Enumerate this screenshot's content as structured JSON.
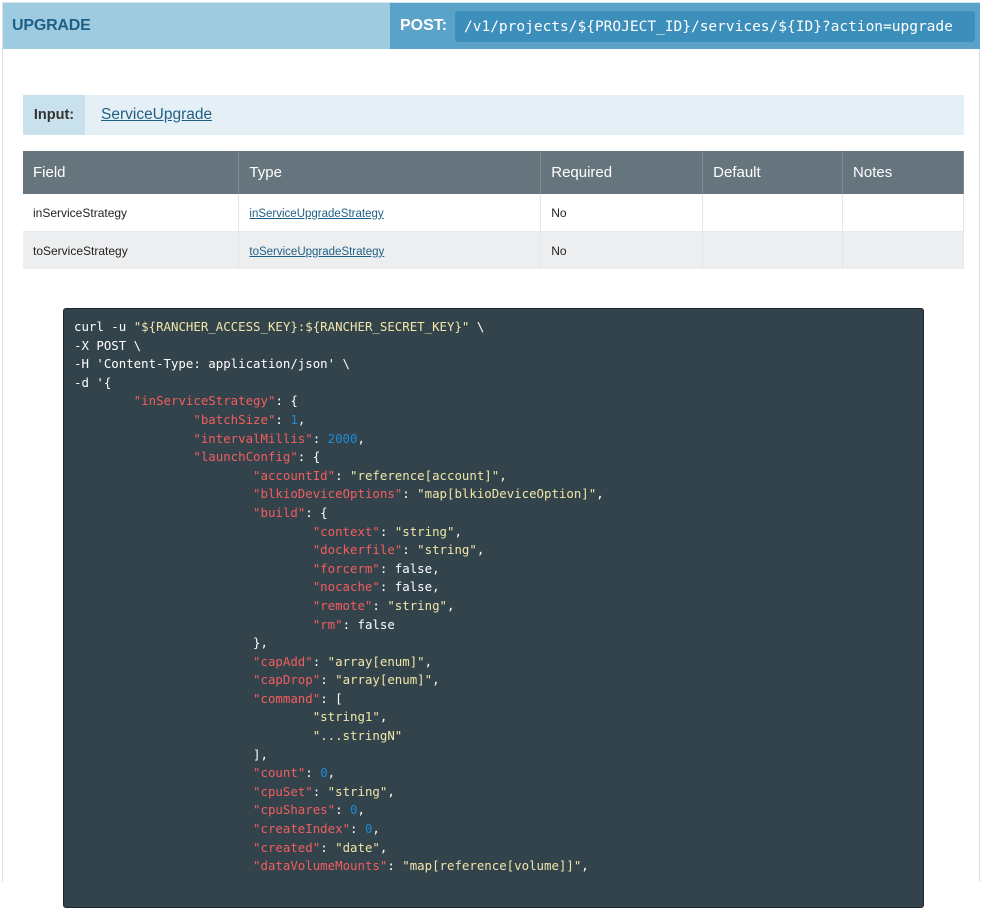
{
  "header": {
    "title": "UPGRADE",
    "method": "POST:",
    "path": "/v1/projects/${PROJECT_ID}/services/${ID}?action=upgrade"
  },
  "input": {
    "label": "Input:",
    "link": "ServiceUpgrade"
  },
  "table": {
    "headers": [
      "Field",
      "Type",
      "Required",
      "Default",
      "Notes"
    ],
    "rows": [
      {
        "field": "inServiceStrategy",
        "type": "inServiceUpgradeStrategy",
        "required": "No",
        "default": "",
        "notes": ""
      },
      {
        "field": "toServiceStrategy",
        "type": "toServiceUpgradeStrategy",
        "required": "No",
        "default": "",
        "notes": ""
      }
    ]
  },
  "code": {
    "lines": [
      [
        {
          "t": "p",
          "v": "curl -u "
        },
        {
          "t": "s",
          "v": "\"${RANCHER_ACCESS_KEY}:${RANCHER_SECRET_KEY}\""
        },
        {
          "t": "p",
          "v": " \\"
        }
      ],
      [
        {
          "t": "p",
          "v": "-X POST \\"
        }
      ],
      [
        {
          "t": "p",
          "v": "-H 'Content-Type: application/json' \\"
        }
      ],
      [
        {
          "t": "p",
          "v": "-d '{"
        }
      ],
      [
        {
          "t": "p",
          "v": "\t"
        },
        {
          "t": "k",
          "v": "\"inServiceStrategy\""
        },
        {
          "t": "p",
          "v": ": {"
        }
      ],
      [
        {
          "t": "p",
          "v": "\t\t"
        },
        {
          "t": "k",
          "v": "\"batchSize\""
        },
        {
          "t": "p",
          "v": ": "
        },
        {
          "t": "n",
          "v": "1"
        },
        {
          "t": "p",
          "v": ","
        }
      ],
      [
        {
          "t": "p",
          "v": "\t\t"
        },
        {
          "t": "k",
          "v": "\"intervalMillis\""
        },
        {
          "t": "p",
          "v": ": "
        },
        {
          "t": "n",
          "v": "2000"
        },
        {
          "t": "p",
          "v": ","
        }
      ],
      [
        {
          "t": "p",
          "v": "\t\t"
        },
        {
          "t": "k",
          "v": "\"launchConfig\""
        },
        {
          "t": "p",
          "v": ": {"
        }
      ],
      [
        {
          "t": "p",
          "v": "\t\t\t"
        },
        {
          "t": "k",
          "v": "\"accountId\""
        },
        {
          "t": "p",
          "v": ": "
        },
        {
          "t": "s",
          "v": "\"reference[account]\""
        },
        {
          "t": "p",
          "v": ","
        }
      ],
      [
        {
          "t": "p",
          "v": "\t\t\t"
        },
        {
          "t": "k",
          "v": "\"blkioDeviceOptions\""
        },
        {
          "t": "p",
          "v": ": "
        },
        {
          "t": "s",
          "v": "\"map[blkioDeviceOption]\""
        },
        {
          "t": "p",
          "v": ","
        }
      ],
      [
        {
          "t": "p",
          "v": "\t\t\t"
        },
        {
          "t": "k",
          "v": "\"build\""
        },
        {
          "t": "p",
          "v": ": {"
        }
      ],
      [
        {
          "t": "p",
          "v": "\t\t\t\t"
        },
        {
          "t": "k",
          "v": "\"context\""
        },
        {
          "t": "p",
          "v": ": "
        },
        {
          "t": "s",
          "v": "\"string\""
        },
        {
          "t": "p",
          "v": ","
        }
      ],
      [
        {
          "t": "p",
          "v": "\t\t\t\t"
        },
        {
          "t": "k",
          "v": "\"dockerfile\""
        },
        {
          "t": "p",
          "v": ": "
        },
        {
          "t": "s",
          "v": "\"string\""
        },
        {
          "t": "p",
          "v": ","
        }
      ],
      [
        {
          "t": "p",
          "v": "\t\t\t\t"
        },
        {
          "t": "k",
          "v": "\"forcerm\""
        },
        {
          "t": "p",
          "v": ": false,"
        }
      ],
      [
        {
          "t": "p",
          "v": "\t\t\t\t"
        },
        {
          "t": "k",
          "v": "\"nocache\""
        },
        {
          "t": "p",
          "v": ": false,"
        }
      ],
      [
        {
          "t": "p",
          "v": "\t\t\t\t"
        },
        {
          "t": "k",
          "v": "\"remote\""
        },
        {
          "t": "p",
          "v": ": "
        },
        {
          "t": "s",
          "v": "\"string\""
        },
        {
          "t": "p",
          "v": ","
        }
      ],
      [
        {
          "t": "p",
          "v": "\t\t\t\t"
        },
        {
          "t": "k",
          "v": "\"rm\""
        },
        {
          "t": "p",
          "v": ": false"
        }
      ],
      [
        {
          "t": "p",
          "v": "\t\t\t},"
        }
      ],
      [
        {
          "t": "p",
          "v": "\t\t\t"
        },
        {
          "t": "k",
          "v": "\"capAdd\""
        },
        {
          "t": "p",
          "v": ": "
        },
        {
          "t": "s",
          "v": "\"array[enum]\""
        },
        {
          "t": "p",
          "v": ","
        }
      ],
      [
        {
          "t": "p",
          "v": "\t\t\t"
        },
        {
          "t": "k",
          "v": "\"capDrop\""
        },
        {
          "t": "p",
          "v": ": "
        },
        {
          "t": "s",
          "v": "\"array[enum]\""
        },
        {
          "t": "p",
          "v": ","
        }
      ],
      [
        {
          "t": "p",
          "v": "\t\t\t"
        },
        {
          "t": "k",
          "v": "\"command\""
        },
        {
          "t": "p",
          "v": ": ["
        }
      ],
      [
        {
          "t": "p",
          "v": "\t\t\t\t"
        },
        {
          "t": "s",
          "v": "\"string1\""
        },
        {
          "t": "p",
          "v": ","
        }
      ],
      [
        {
          "t": "p",
          "v": "\t\t\t\t"
        },
        {
          "t": "s",
          "v": "\"...stringN\""
        }
      ],
      [
        {
          "t": "p",
          "v": "\t\t\t],"
        }
      ],
      [
        {
          "t": "p",
          "v": "\t\t\t"
        },
        {
          "t": "k",
          "v": "\"count\""
        },
        {
          "t": "p",
          "v": ": "
        },
        {
          "t": "n",
          "v": "0"
        },
        {
          "t": "p",
          "v": ","
        }
      ],
      [
        {
          "t": "p",
          "v": "\t\t\t"
        },
        {
          "t": "k",
          "v": "\"cpuSet\""
        },
        {
          "t": "p",
          "v": ": "
        },
        {
          "t": "s",
          "v": "\"string\""
        },
        {
          "t": "p",
          "v": ","
        }
      ],
      [
        {
          "t": "p",
          "v": "\t\t\t"
        },
        {
          "t": "k",
          "v": "\"cpuShares\""
        },
        {
          "t": "p",
          "v": ": "
        },
        {
          "t": "n",
          "v": "0"
        },
        {
          "t": "p",
          "v": ","
        }
      ],
      [
        {
          "t": "p",
          "v": "\t\t\t"
        },
        {
          "t": "k",
          "v": "\"createIndex\""
        },
        {
          "t": "p",
          "v": ": "
        },
        {
          "t": "n",
          "v": "0"
        },
        {
          "t": "p",
          "v": ","
        }
      ],
      [
        {
          "t": "p",
          "v": "\t\t\t"
        },
        {
          "t": "k",
          "v": "\"created\""
        },
        {
          "t": "p",
          "v": ": "
        },
        {
          "t": "s",
          "v": "\"date\""
        },
        {
          "t": "p",
          "v": ","
        }
      ],
      [
        {
          "t": "p",
          "v": "\t\t\t"
        },
        {
          "t": "k",
          "v": "\"dataVolumeMounts\""
        },
        {
          "t": "p",
          "v": ": "
        },
        {
          "t": "s",
          "v": "\"map[reference[volume]]\""
        },
        {
          "t": "p",
          "v": ","
        }
      ]
    ]
  },
  "colors": {
    "header_left": "#9fcbe0",
    "header_right": "#5aa2c8",
    "path_box": "#3c8fba",
    "table_header": "#66747d",
    "code_bg": "#33434c",
    "code_key": "#f25d5d",
    "code_string": "#f0e6a8",
    "code_number": "#1d8ad2"
  }
}
